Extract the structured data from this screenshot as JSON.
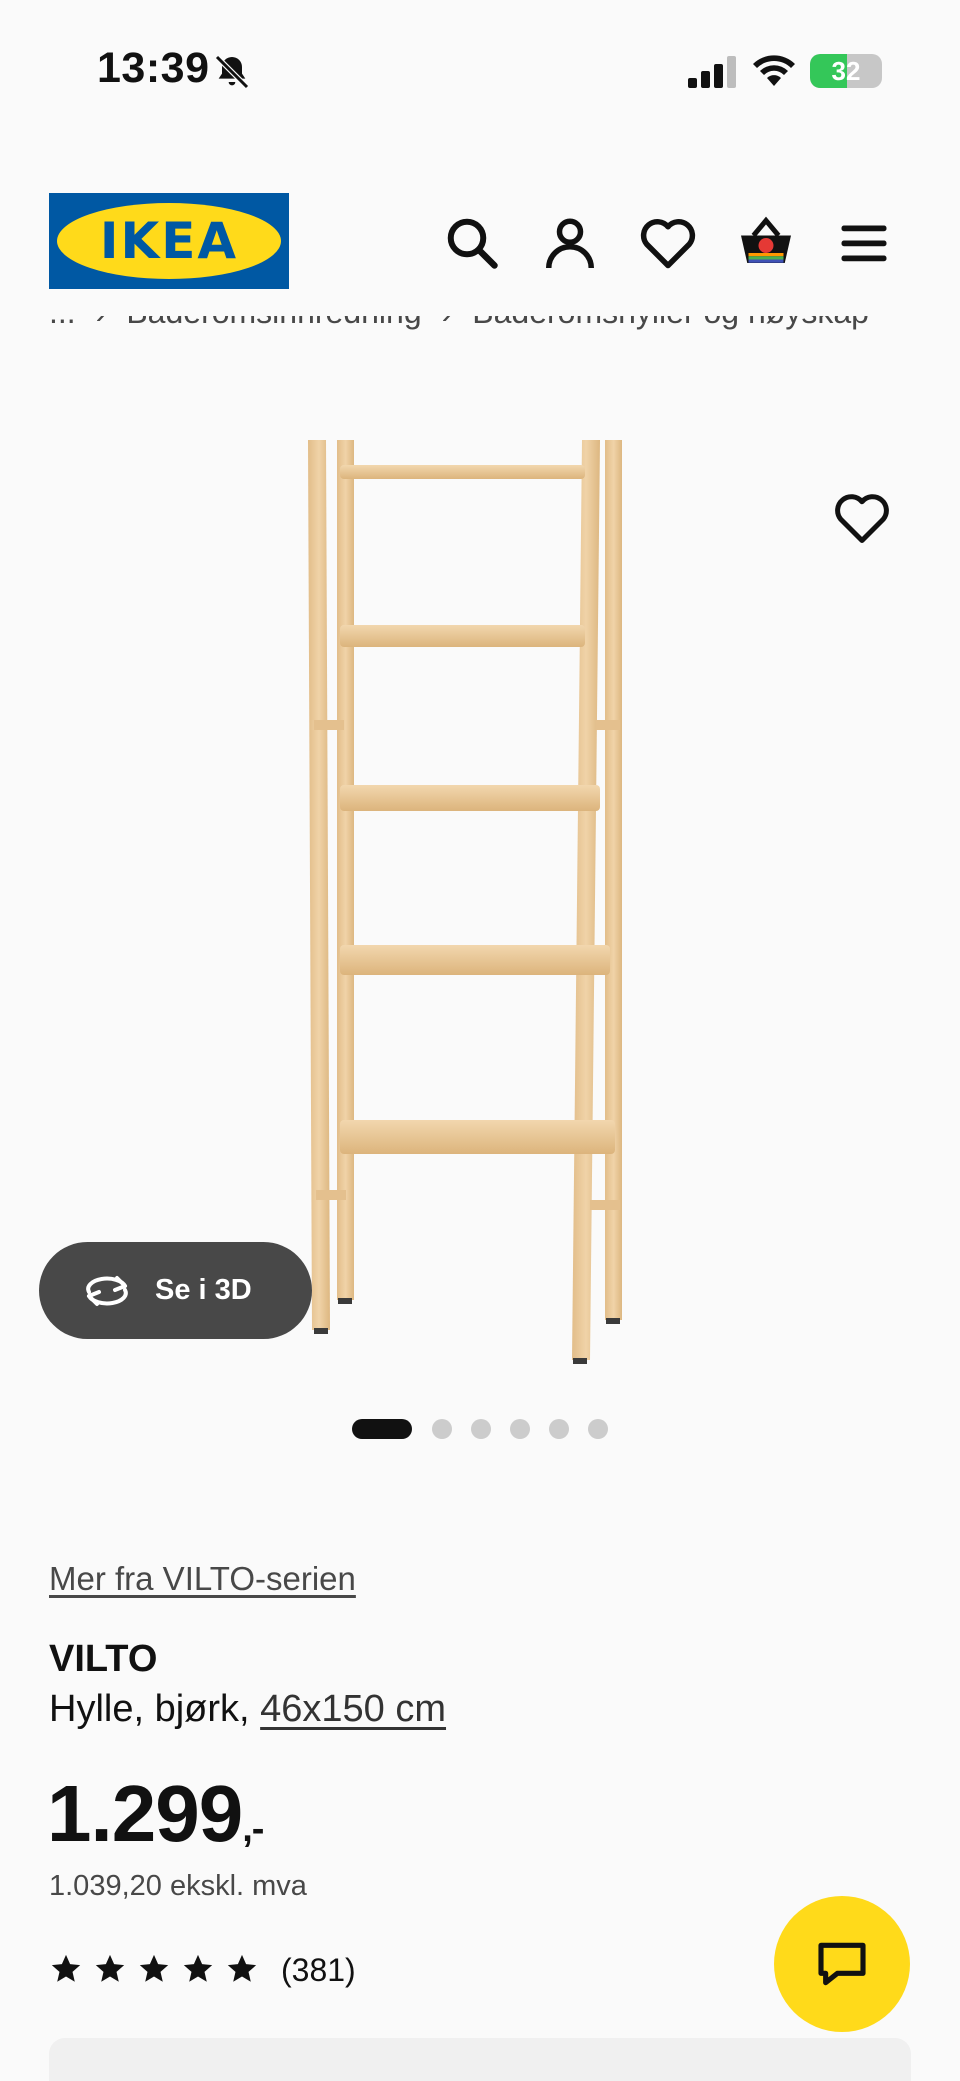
{
  "status_bar": {
    "time": "13:39",
    "battery_level": "32",
    "icons": [
      "bell-slash-icon",
      "cellular-signal-icon",
      "wifi-icon",
      "battery-charging-icon"
    ]
  },
  "header": {
    "logo_text": "IKEA",
    "icons": [
      "search-icon",
      "user-icon",
      "heart-icon",
      "shopping-basket-icon",
      "menu-icon"
    ]
  },
  "breadcrumb": {
    "ellipsis": "...",
    "items": [
      "Baderomsinnredning",
      "Baderomshyller og høyskap"
    ]
  },
  "gallery": {
    "see_3d_label": "Se i 3D",
    "image_count": 6,
    "active_index": 0
  },
  "product": {
    "series_link": "Mer fra VILTO-serien",
    "name": "VILTO",
    "description": "Hylle, bjørk,",
    "size_link": "46x150 cm",
    "price_main": "1.299",
    "price_suffix": ",-",
    "price_ex_vat": "1.039,20 ekskl. mva",
    "rating_stars": 5,
    "rating_count": "(381)"
  },
  "colors": {
    "ikea_blue": "#0058a3",
    "ikea_yellow": "#ffda1a",
    "wood": "#e9c99b",
    "button_dark": "#484848"
  }
}
